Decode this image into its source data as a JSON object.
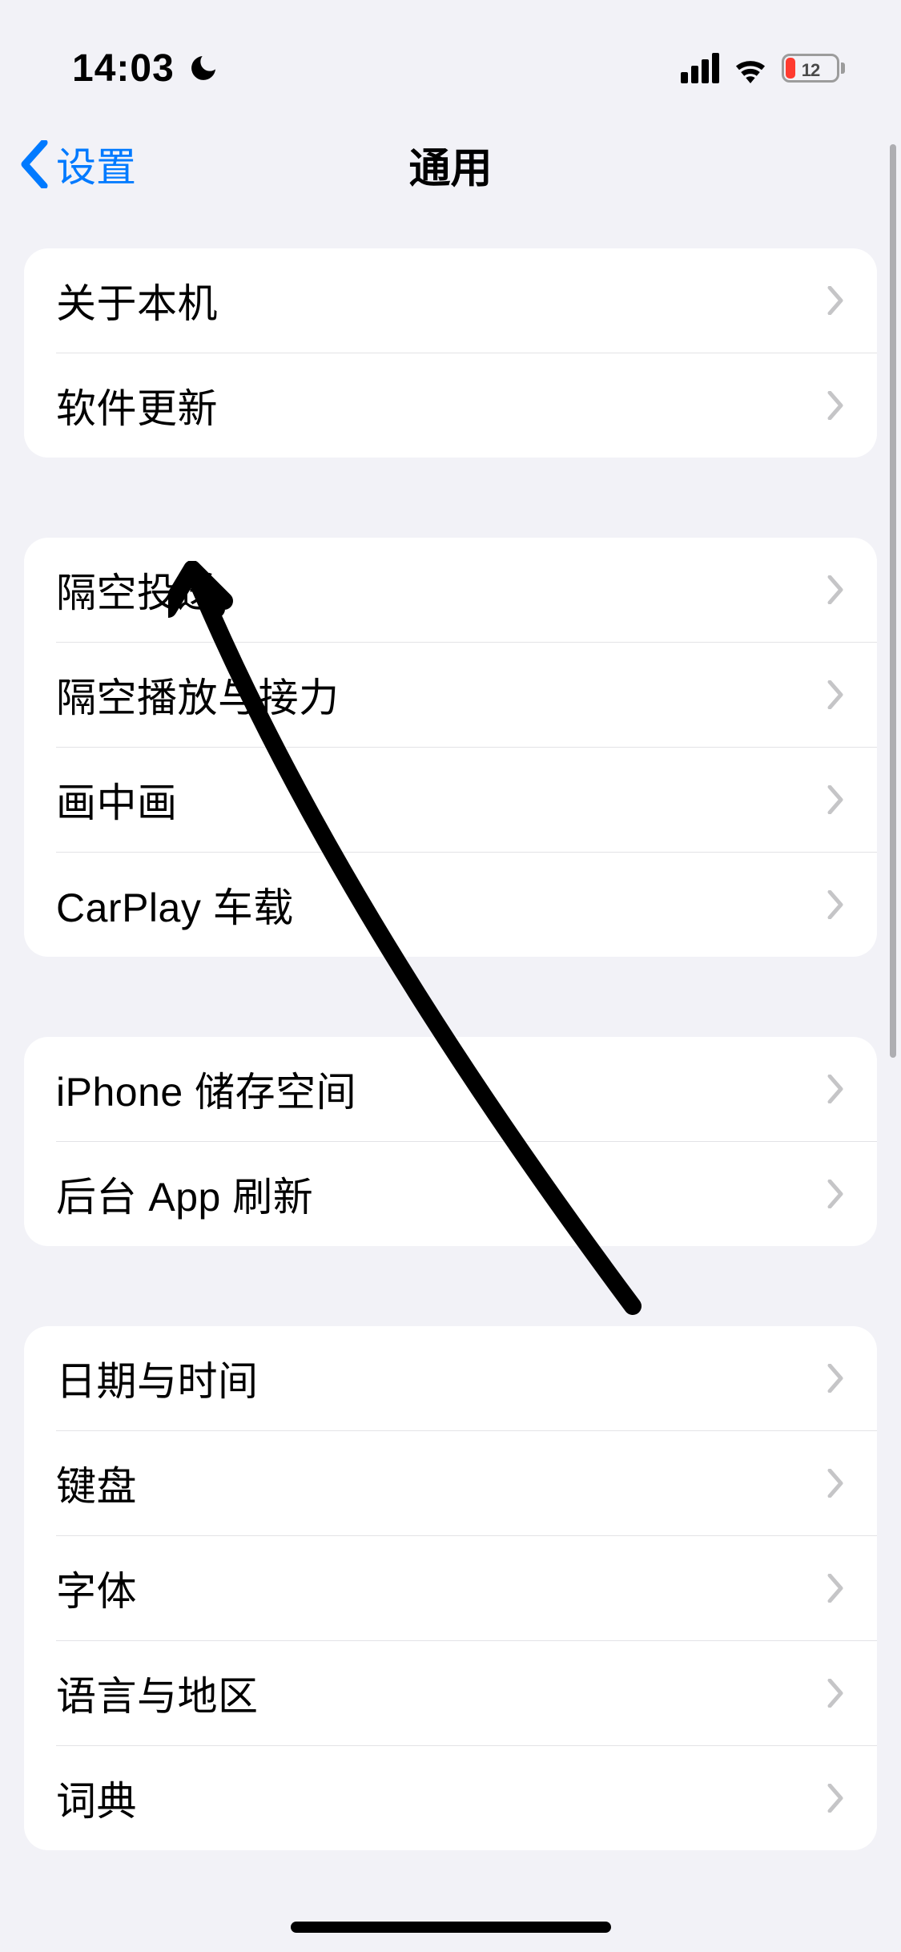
{
  "status": {
    "time": "14:03",
    "dnd": true,
    "battery_pct": "12"
  },
  "nav": {
    "back_label": "设置",
    "title": "通用"
  },
  "groups": [
    {
      "items": [
        {
          "label": "关于本机"
        },
        {
          "label": "软件更新"
        }
      ]
    },
    {
      "items": [
        {
          "label": "隔空投送"
        },
        {
          "label": "隔空播放与接力"
        },
        {
          "label": "画中画"
        },
        {
          "label": "CarPlay 车载"
        }
      ]
    },
    {
      "items": [
        {
          "label": "iPhone 储存空间"
        },
        {
          "label": "后台 App 刷新"
        }
      ]
    },
    {
      "items": [
        {
          "label": "日期与时间"
        },
        {
          "label": "键盘"
        },
        {
          "label": "字体"
        },
        {
          "label": "语言与地区"
        },
        {
          "label": "词典"
        }
      ]
    }
  ]
}
